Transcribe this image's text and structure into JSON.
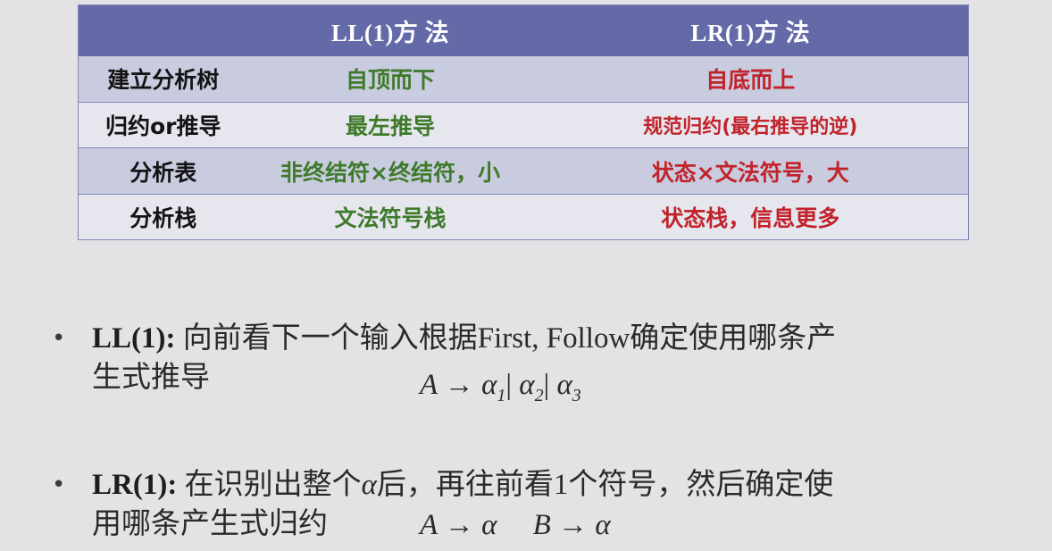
{
  "table": {
    "headers": [
      "",
      "LL(1)方 法",
      "LR(1)方 法"
    ],
    "rows": [
      {
        "label": "建立分析树",
        "ll": "自顶而下",
        "lr": "自底而上"
      },
      {
        "label": "归约or推导",
        "ll": "最左推导",
        "lr": "规范归约(最右推导的逆)"
      },
      {
        "label": "分析表",
        "ll": "非终结符×终结符，小",
        "lr": "状态×文法符号，大"
      },
      {
        "label": "分析栈",
        "ll": "文法符号栈",
        "lr": "状态栈，信息更多"
      }
    ],
    "colors": {
      "header_bg": "#6469a8",
      "ll_text": "#3f7a2b",
      "lr_text": "#c1232b"
    }
  },
  "bullets": [
    {
      "marker": "•",
      "label": "LL(1):",
      "text_line1": " 向前看下一个输入根据First, Follow确定使用哪条产",
      "text_line2": "生式推导",
      "formula": {
        "lhs": "A",
        "arrow": "→",
        "alt1": "α",
        "sub1": "1",
        "sep": "|",
        "alt2": "α",
        "sub2": "2",
        "alt3": "α",
        "sub3": "3"
      }
    },
    {
      "marker": "•",
      "label": "LR(1):",
      "text_line1_a": " 在识别出整个",
      "alpha": "α",
      "text_line1_b": "后，再往前看1个符号，然后确定使",
      "text_line2": "用哪条产生式归约",
      "formula": {
        "rule1_lhs": "A",
        "arrow": "→",
        "rule1_rhs": "α",
        "rule2_lhs": "B",
        "rule2_rhs": "α"
      }
    }
  ]
}
